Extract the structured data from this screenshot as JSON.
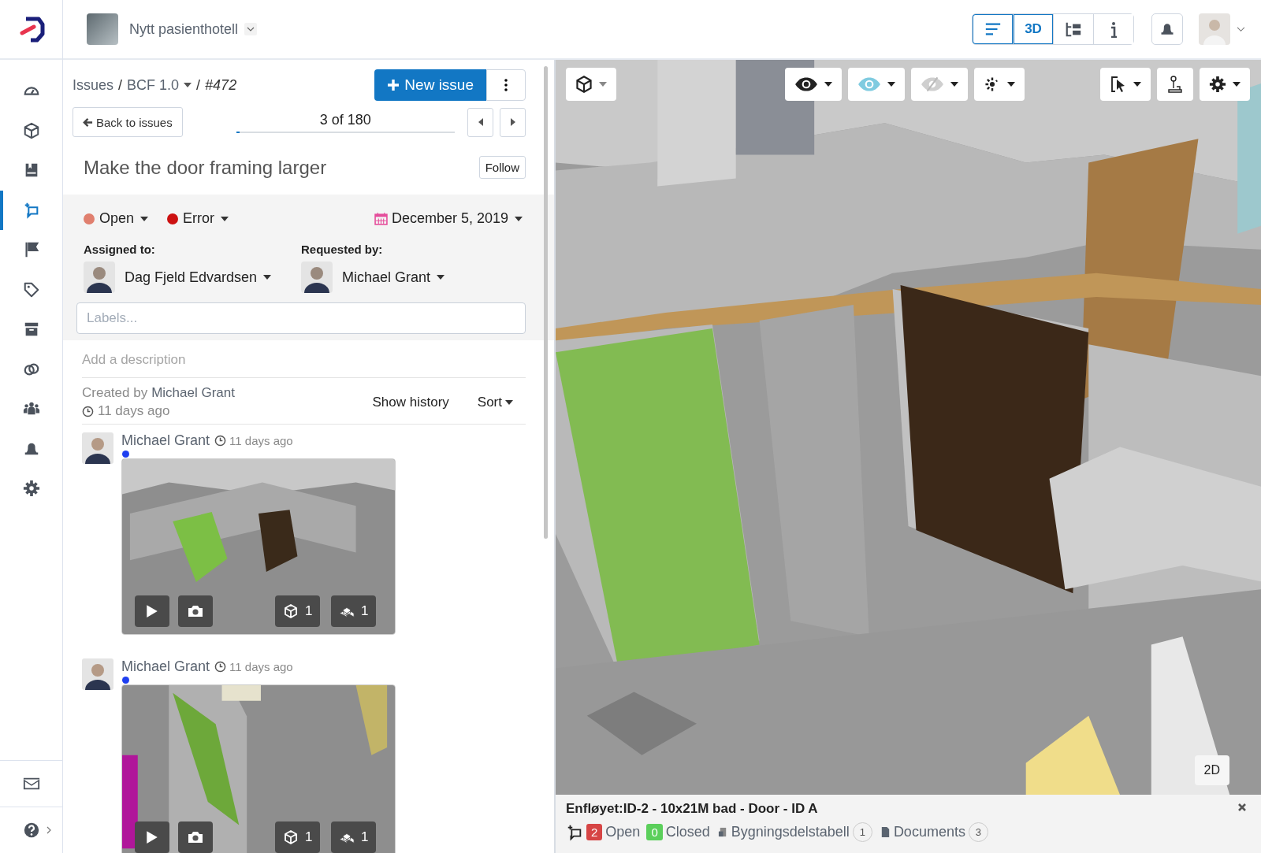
{
  "project": {
    "name": "Nytt pasienthotell"
  },
  "sidebar": {
    "items": [
      {
        "kind": "dashboard",
        "selected": false
      },
      {
        "kind": "cube",
        "selected": false
      },
      {
        "kind": "book",
        "selected": false
      },
      {
        "kind": "issues",
        "selected": true
      },
      {
        "kind": "flag",
        "selected": false
      },
      {
        "kind": "tag",
        "selected": false
      },
      {
        "kind": "archive",
        "selected": false
      },
      {
        "kind": "link",
        "selected": false
      },
      {
        "kind": "people",
        "selected": false
      },
      {
        "kind": "bell",
        "selected": false
      },
      {
        "kind": "gear",
        "selected": false
      }
    ],
    "footer": [
      {
        "kind": "mail"
      },
      {
        "kind": "help"
      }
    ]
  },
  "views": [
    {
      "kind": "list",
      "selected": true
    },
    {
      "kind": "label",
      "label": "3D",
      "selected": true
    },
    {
      "kind": "tree",
      "selected": false
    },
    {
      "kind": "info",
      "selected": false
    }
  ],
  "issue": {
    "breadcrumb": [
      {
        "label": "Issues",
        "dropdown": false,
        "italic": false
      },
      {
        "label": "BCF 1.0",
        "dropdown": true,
        "italic": false
      },
      {
        "label": "#472",
        "dropdown": false,
        "italic": true
      }
    ],
    "separator": "/",
    "new_issue": "New issue",
    "back": "Back to issues",
    "position": "3 of 180",
    "level": 0.017,
    "title": "Make the door framing larger",
    "follow": "Follow",
    "tags": [
      {
        "label": "Open",
        "color": "#e07f6e"
      },
      {
        "label": "Error",
        "color": "#cc1111"
      }
    ],
    "due": "December 5, 2019",
    "people": [
      {
        "role": "Assigned to:",
        "name": "Dag Fjeld Edvardsen"
      },
      {
        "role": "Requested by:",
        "name": "Michael Grant"
      }
    ],
    "labels_placeholder": "Labels...",
    "description_placeholder": "Add a description",
    "created_prefix": "Created by",
    "created_by": "Michael Grant",
    "created_time": "11 days ago",
    "show_history": "Show history",
    "sort": "Sort"
  },
  "comments": [
    {
      "author": "Michael Grant",
      "time": "11 days ago",
      "models": "1",
      "objects": "1"
    },
    {
      "author": "Michael Grant",
      "time": "11 days ago",
      "models": "1",
      "objects": "1"
    }
  ],
  "viewer": {
    "two_d": "2D",
    "selection": {
      "title": "Enfløyet:ID-2 - 10x21M bad - Door - ID A",
      "open_count": "2",
      "open": "Open",
      "closed_count": "0",
      "closed": "Closed",
      "table": "Bygningsdelstabell",
      "table_count": "1",
      "documents": "Documents",
      "documents_count": "3"
    }
  }
}
